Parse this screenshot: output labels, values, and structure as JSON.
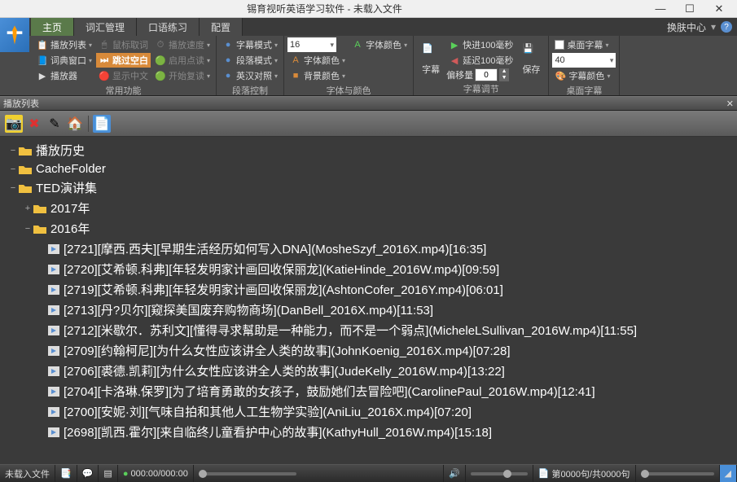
{
  "titlebar": {
    "title": "锡育视听英语学习软件 - 未载入文件"
  },
  "tabs": [
    "主页",
    "词汇管理",
    "口语练习",
    "配置"
  ],
  "header_right": "换肤中心",
  "ribbon": {
    "g1": {
      "label": "常用功能",
      "items": [
        "播放列表",
        "鼠标取词",
        "播放速度",
        "词典窗口",
        "跳过空白",
        "启用点读",
        "播放器",
        "显示中文",
        "开始复读"
      ]
    },
    "g2": {
      "label": "段落控制",
      "items": [
        "字幕模式",
        "段落模式",
        "英汉对照"
      ]
    },
    "g3": {
      "label": "字体与颜色",
      "items": [
        "字体颜色",
        "字体颜色",
        "背景颜色"
      ],
      "fontsize": "16"
    },
    "g4": {
      "label": "字幕调节",
      "big": "字幕",
      "items": [
        "快进100毫秒",
        "延迟100毫秒"
      ],
      "offset_label": "偏移量",
      "offset_value": "0",
      "save": "保存"
    },
    "g5": {
      "label": "桌面字幕",
      "check": "桌面字幕",
      "size": "40",
      "item": "字幕颜色"
    }
  },
  "panel_title": "播放列表",
  "tree": {
    "roots": [
      "播放历史",
      "CacheFolder",
      "TED演讲集"
    ],
    "years": [
      "2017年",
      "2016年"
    ],
    "files": [
      "[2721][摩西.西夫][早期生活经历如何写入DNA](MosheSzyf_2016X.mp4)[16:35]",
      "[2720][艾希顿.科弗][年轻发明家计画回收保丽龙](KatieHinde_2016W.mp4)[09:59]",
      "[2719][艾希顿.科弗][年轻发明家计画回收保丽龙](AshtonCofer_2016Y.mp4)[06:01]",
      "[2713][丹?贝尔][窥探美国废弃购物商场](DanBell_2016X.mp4)[11:53]",
      "[2712][米歇尔．苏利文][懂得寻求幫助是一种能力，而不是一个弱点](MicheleLSullivan_2016W.mp4)[11:55]",
      "[2709][约翰柯尼][为什么女性应该讲全人类的故事](JohnKoenig_2016X.mp4)[07:28]",
      "[2706][裘德.凯莉][为什么女性应该讲全人类的故事](JudeKelly_2016W.mp4)[13:22]",
      "[2704][卡洛琳.保罗][为了培育勇敢的女孩子，鼓励她们去冒险吧](CarolinePaul_2016W.mp4)[12:41]",
      "[2700][安妮·刘][气味自拍和其他人工生物学实验](AniLiu_2016X.mp4)[07:20]",
      "[2698][凯西.霍尔][来自临终儿童看护中心的故事](KathyHull_2016W.mp4)[15:18]"
    ]
  },
  "status": {
    "file": "未载入文件",
    "time": "000:00/000:00",
    "sentence": "第0000句/共0000句"
  }
}
